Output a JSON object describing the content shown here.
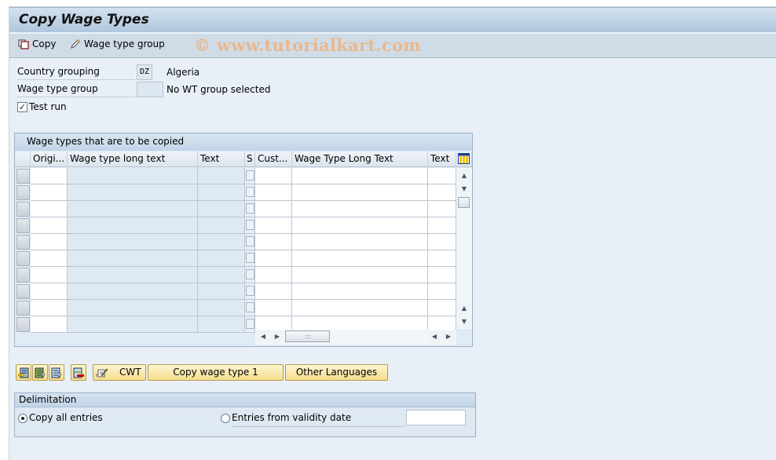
{
  "window": {
    "title": "Copy Wage Types"
  },
  "toolbar": {
    "copy_label": "Copy",
    "wage_type_group_label": "Wage type group",
    "watermark": "© www.tutorialkart.com"
  },
  "form": {
    "country_grouping": {
      "label": "Country grouping",
      "value": "DZ",
      "description": "Algeria"
    },
    "wage_type_group": {
      "label": "Wage type group",
      "value": "",
      "description": "No WT group selected"
    },
    "test_run": {
      "label": "Test run",
      "checked": true,
      "mark": "✓"
    }
  },
  "table": {
    "title": "Wage types that are to be copied",
    "columns": [
      "Origi...",
      "Wage type long text",
      "Text",
      "S",
      "Cust...",
      "Wage Type Long Text",
      "Text"
    ],
    "row_count": 10,
    "rows": [],
    "icons": {
      "layout": "column-layout-icon",
      "scroll_up": "▲",
      "scroll_down": "▼",
      "left": "◀",
      "right": "▶",
      "grip": ":::"
    }
  },
  "buttons": {
    "cwt_label": "CWT",
    "copy_wage_type_label": "Copy wage type 1",
    "other_languages_label": "Other Languages"
  },
  "delimitation": {
    "title": "Delimitation",
    "options": [
      {
        "label": "Copy all entries",
        "selected": true
      },
      {
        "label": "Entries from validity date",
        "selected": false
      }
    ],
    "validity_date_value": ""
  }
}
